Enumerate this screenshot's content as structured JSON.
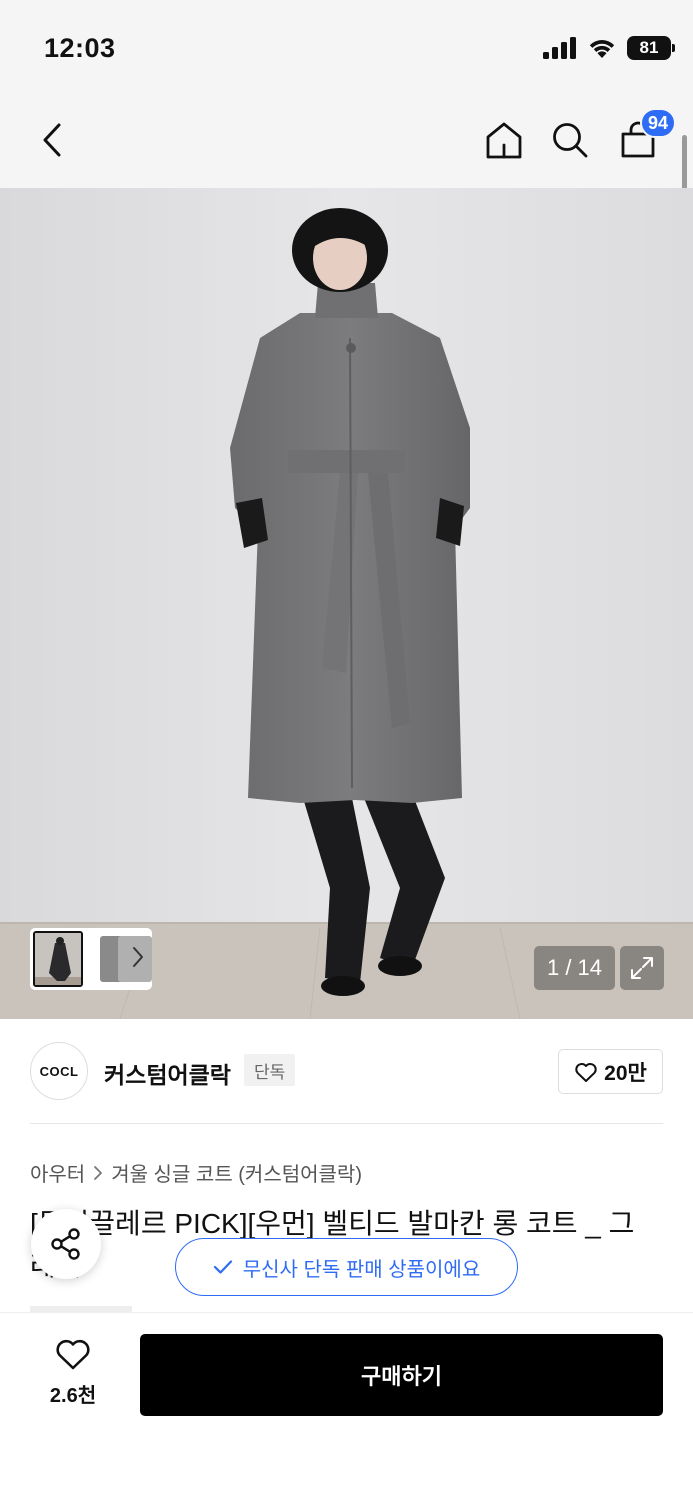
{
  "status_bar": {
    "time": "12:03",
    "battery": "81",
    "icons": [
      "signal-icon",
      "wifi-icon",
      "battery-icon"
    ]
  },
  "nav": {
    "icons": [
      "back-icon",
      "home-icon",
      "search-icon",
      "cart-icon"
    ],
    "cart_badge": "94"
  },
  "gallery": {
    "counter": "1 / 14",
    "icons": [
      "chevron-right-icon",
      "expand-icon"
    ]
  },
  "brand": {
    "logo_text": "COCL",
    "name": "커스텀어클락",
    "tag": "단독",
    "like_count": "20만"
  },
  "breadcrumb": {
    "level1": "아우터",
    "level2": "겨울 싱글 코트 (커스텀어클락)"
  },
  "product": {
    "title": "[무신끌레르 PICK][우먼] 벨티드 발마칸 롱 코트 _ 그레이"
  },
  "toast": {
    "text": "무신사 단독 판매 상품이에요",
    "icon": "check-icon"
  },
  "bottom_bar": {
    "wish_count": "2.6천",
    "buy_label": "구매하기"
  },
  "colors": {
    "accent_blue": "#2f6cf6",
    "buy_button": "#000000",
    "header_bg": "#f5f5f5"
  }
}
